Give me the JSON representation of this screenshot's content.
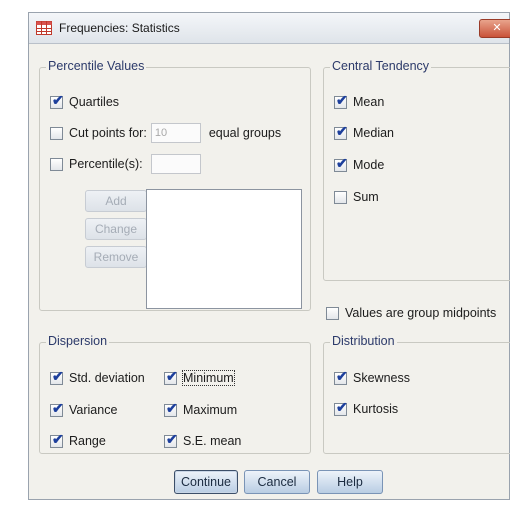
{
  "window": {
    "title": "Frequencies: Statistics",
    "close_glyph": "✕"
  },
  "percentile": {
    "legend": "Percentile Values",
    "quartiles": "Quartiles",
    "cut_points": "Cut points for:",
    "cut_value": "10",
    "equal_groups": "equal groups",
    "percentiles": "Percentile(s):",
    "add": "Add",
    "change": "Change",
    "remove": "Remove"
  },
  "central": {
    "legend": "Central Tendency",
    "mean": "Mean",
    "median": "Median",
    "mode": "Mode",
    "sum": "Sum"
  },
  "midpoints": "Values are group midpoints",
  "dispersion": {
    "legend": "Dispersion",
    "std": "Std. deviation",
    "minimum": "Minimum",
    "variance": "Variance",
    "maximum": "Maximum",
    "range": "Range",
    "se_mean": "S.E. mean"
  },
  "distribution": {
    "legend": "Distribution",
    "skewness": "Skewness",
    "kurtosis": "Kurtosis"
  },
  "buttons": {
    "continue": "Continue",
    "cancel": "Cancel",
    "help": "Help"
  },
  "check_glyph": "✔",
  "colors": {
    "accent": "#1d3f9c",
    "legend_text": "#2c3a6a",
    "close": "#c9533a"
  }
}
